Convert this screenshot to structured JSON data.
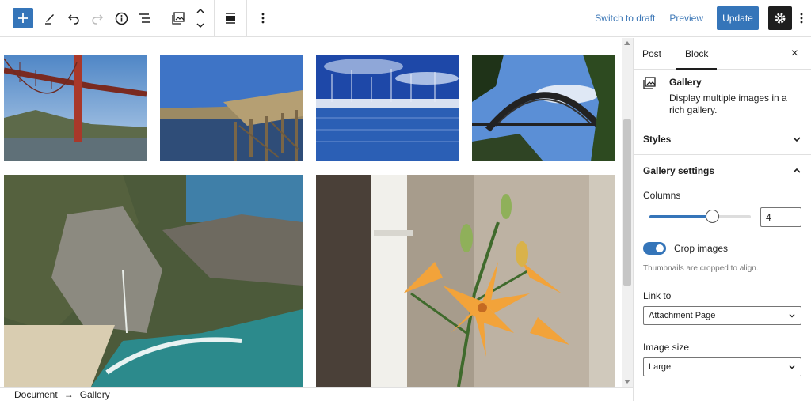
{
  "toolbar": {
    "add_icon": "plus-icon",
    "icons": [
      "pencil-icon",
      "undo-icon",
      "redo-icon",
      "info-icon",
      "list-view-icon"
    ],
    "block_icons": [
      "gallery-icon",
      "move-up-icon",
      "move-down-icon",
      "align-icon",
      "more-options-icon"
    ],
    "switch_to_draft": "Switch to draft",
    "preview": "Preview",
    "update": "Update",
    "settings_icon": "gear-icon",
    "options_icon": "kebab-menu-icon"
  },
  "gallery": {
    "images": [
      {
        "subject": "golden-gate-bridge"
      },
      {
        "subject": "wooden-pier"
      },
      {
        "subject": "marina-boats"
      },
      {
        "subject": "harbour-arch-bridge"
      },
      {
        "subject": "coastal-cove-waterfall"
      },
      {
        "subject": "orange-lily-flower"
      }
    ]
  },
  "breadcrumb": {
    "items": [
      "Document",
      "Gallery"
    ],
    "separator": "→"
  },
  "sidebar": {
    "tabs": [
      {
        "label": "Post",
        "active": false
      },
      {
        "label": "Block",
        "active": true
      }
    ],
    "close": "×",
    "block": {
      "title": "Gallery",
      "description": "Display multiple images in a rich gallery."
    },
    "styles_label": "Styles",
    "gallery_settings_label": "Gallery settings",
    "columns_label": "Columns",
    "columns_value": "4",
    "columns_slider_fraction": 0.62,
    "crop_label": "Crop images",
    "crop_enabled": true,
    "crop_help": "Thumbnails are cropped to align.",
    "link_to_label": "Link to",
    "link_to_value": "Attachment Page",
    "image_size_label": "Image size",
    "image_size_value": "Large"
  },
  "colors": {
    "accent": "#3575b9",
    "dark": "#1e1e1e",
    "border": "#e0e0e0"
  }
}
